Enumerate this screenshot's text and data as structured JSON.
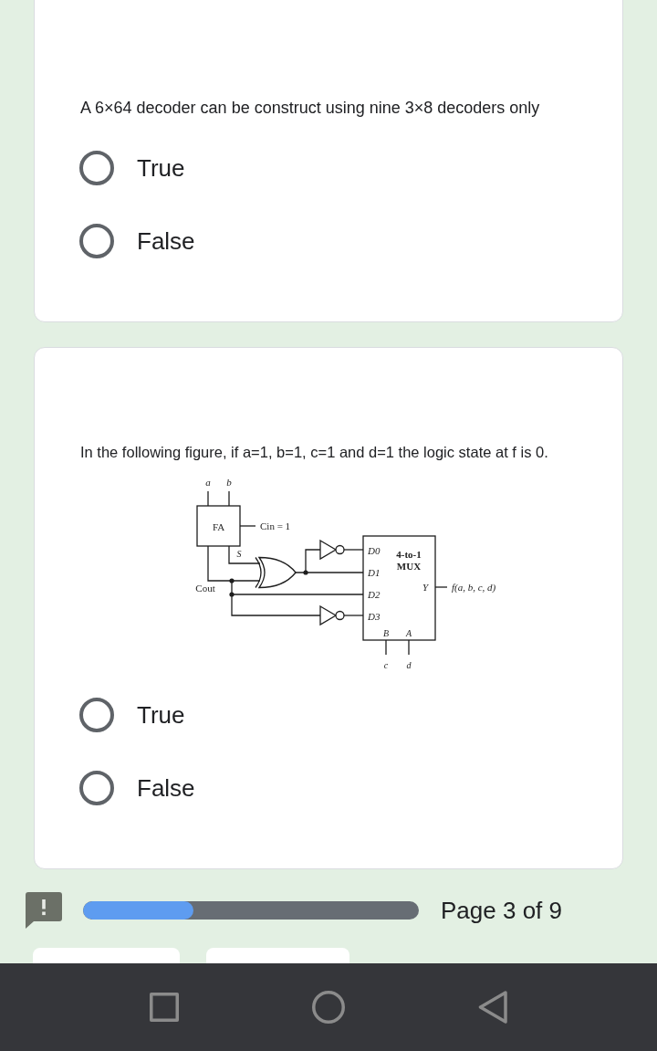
{
  "questions": [
    {
      "text": "A 6×64 decoder can be construct using nine 3×8 decoders only",
      "options": [
        {
          "label": "True",
          "selected": false
        },
        {
          "label": "False",
          "selected": false
        }
      ]
    },
    {
      "text": "In the following figure, if a=1, b=1, c=1 and d=1 the logic state at f is 0.",
      "figure": {
        "adder": {
          "label": "FA",
          "inputs": [
            "a",
            "b"
          ],
          "carry_in": "Cin = 1",
          "sum": "S",
          "carry_out": "Cout"
        },
        "mux": {
          "title": [
            "4-to-1",
            "MUX"
          ],
          "data_inputs": [
            "D0",
            "D1",
            "D2",
            "D3"
          ],
          "output": "Y",
          "output_signal": "f(a, b, c, d)",
          "selects": [
            "B",
            "A"
          ],
          "select_signals": [
            "c",
            "d"
          ]
        }
      },
      "options": [
        {
          "label": "True",
          "selected": false
        },
        {
          "label": "False",
          "selected": false
        }
      ]
    }
  ],
  "footer": {
    "progress": {
      "level": 0.33
    },
    "page_label": "Page 3 of 9"
  }
}
